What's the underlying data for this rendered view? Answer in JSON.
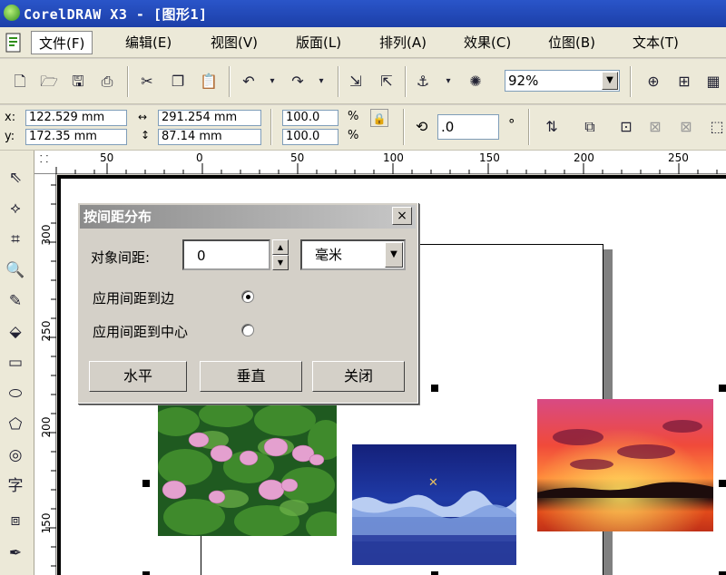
{
  "window": {
    "title": "CorelDRAW X3 - [图形1]"
  },
  "menu": [
    {
      "label": "文件(F)",
      "active": true
    },
    {
      "label": "编辑(E)"
    },
    {
      "label": "视图(V)"
    },
    {
      "label": "版面(L)"
    },
    {
      "label": "排列(A)"
    },
    {
      "label": "效果(C)"
    },
    {
      "label": "位图(B)"
    },
    {
      "label": "文本(T)"
    }
  ],
  "toolbar": {
    "zoom": "92%"
  },
  "propbar": {
    "x_label": "x:",
    "y_label": "y:",
    "x_value": "122.529 mm",
    "y_value": "172.35 mm",
    "width_value": "291.254 mm",
    "height_value": "87.14 mm",
    "scale_x": "100.0",
    "scale_y": "100.0",
    "percent": "%",
    "rotation": ".0",
    "degree": "°"
  },
  "ruler": {
    "h_ticks": [
      "50",
      "0",
      "50",
      "100",
      "150",
      "200",
      "250"
    ],
    "v_ticks": [
      "300",
      "250",
      "200",
      "150"
    ]
  },
  "dialog": {
    "title": "按间距分布",
    "close": "×",
    "spacing_label": "对象间距:",
    "spacing_value": "0",
    "unit": "毫米",
    "option_edge": "应用间距到边",
    "option_center": "应用间距到中心",
    "btn_horizontal": "水平",
    "btn_vertical": "垂直",
    "btn_close": "关闭"
  },
  "colors": {
    "titlebar": "#1c3fa8",
    "menubar": "#ece9d8",
    "dialog_title": "#8b8b8b"
  }
}
